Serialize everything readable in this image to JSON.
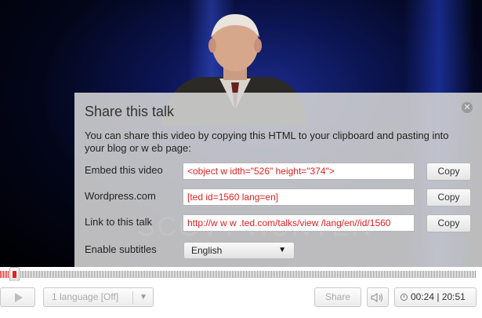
{
  "share_panel": {
    "title": "Share this talk",
    "description": "You can share this video by copying this HTML to your clipboard and pasting into your blog or w eb page:",
    "close_icon": "close-icon",
    "rows": [
      {
        "label": "Embed this video",
        "value": "<object w idth=\"526\" height=\"374\">",
        "copy": "Copy"
      },
      {
        "label": "Wordpress.com",
        "value": "[ted id=1560 lang=en]",
        "copy": "Copy"
      },
      {
        "label": "Link to this talk",
        "value": "http://w w w .ted.com/talks/view /lang/en//id/1560",
        "copy": "Copy"
      }
    ],
    "subtitles_label": "Enable subtitles",
    "subtitles_value": "English"
  },
  "player": {
    "progress_fraction": 0.02,
    "language_button": "1 language [Off]",
    "share_button": "Share",
    "time_display": "00:24 | 20:51",
    "colors": {
      "accent": "#e0231b"
    }
  }
}
